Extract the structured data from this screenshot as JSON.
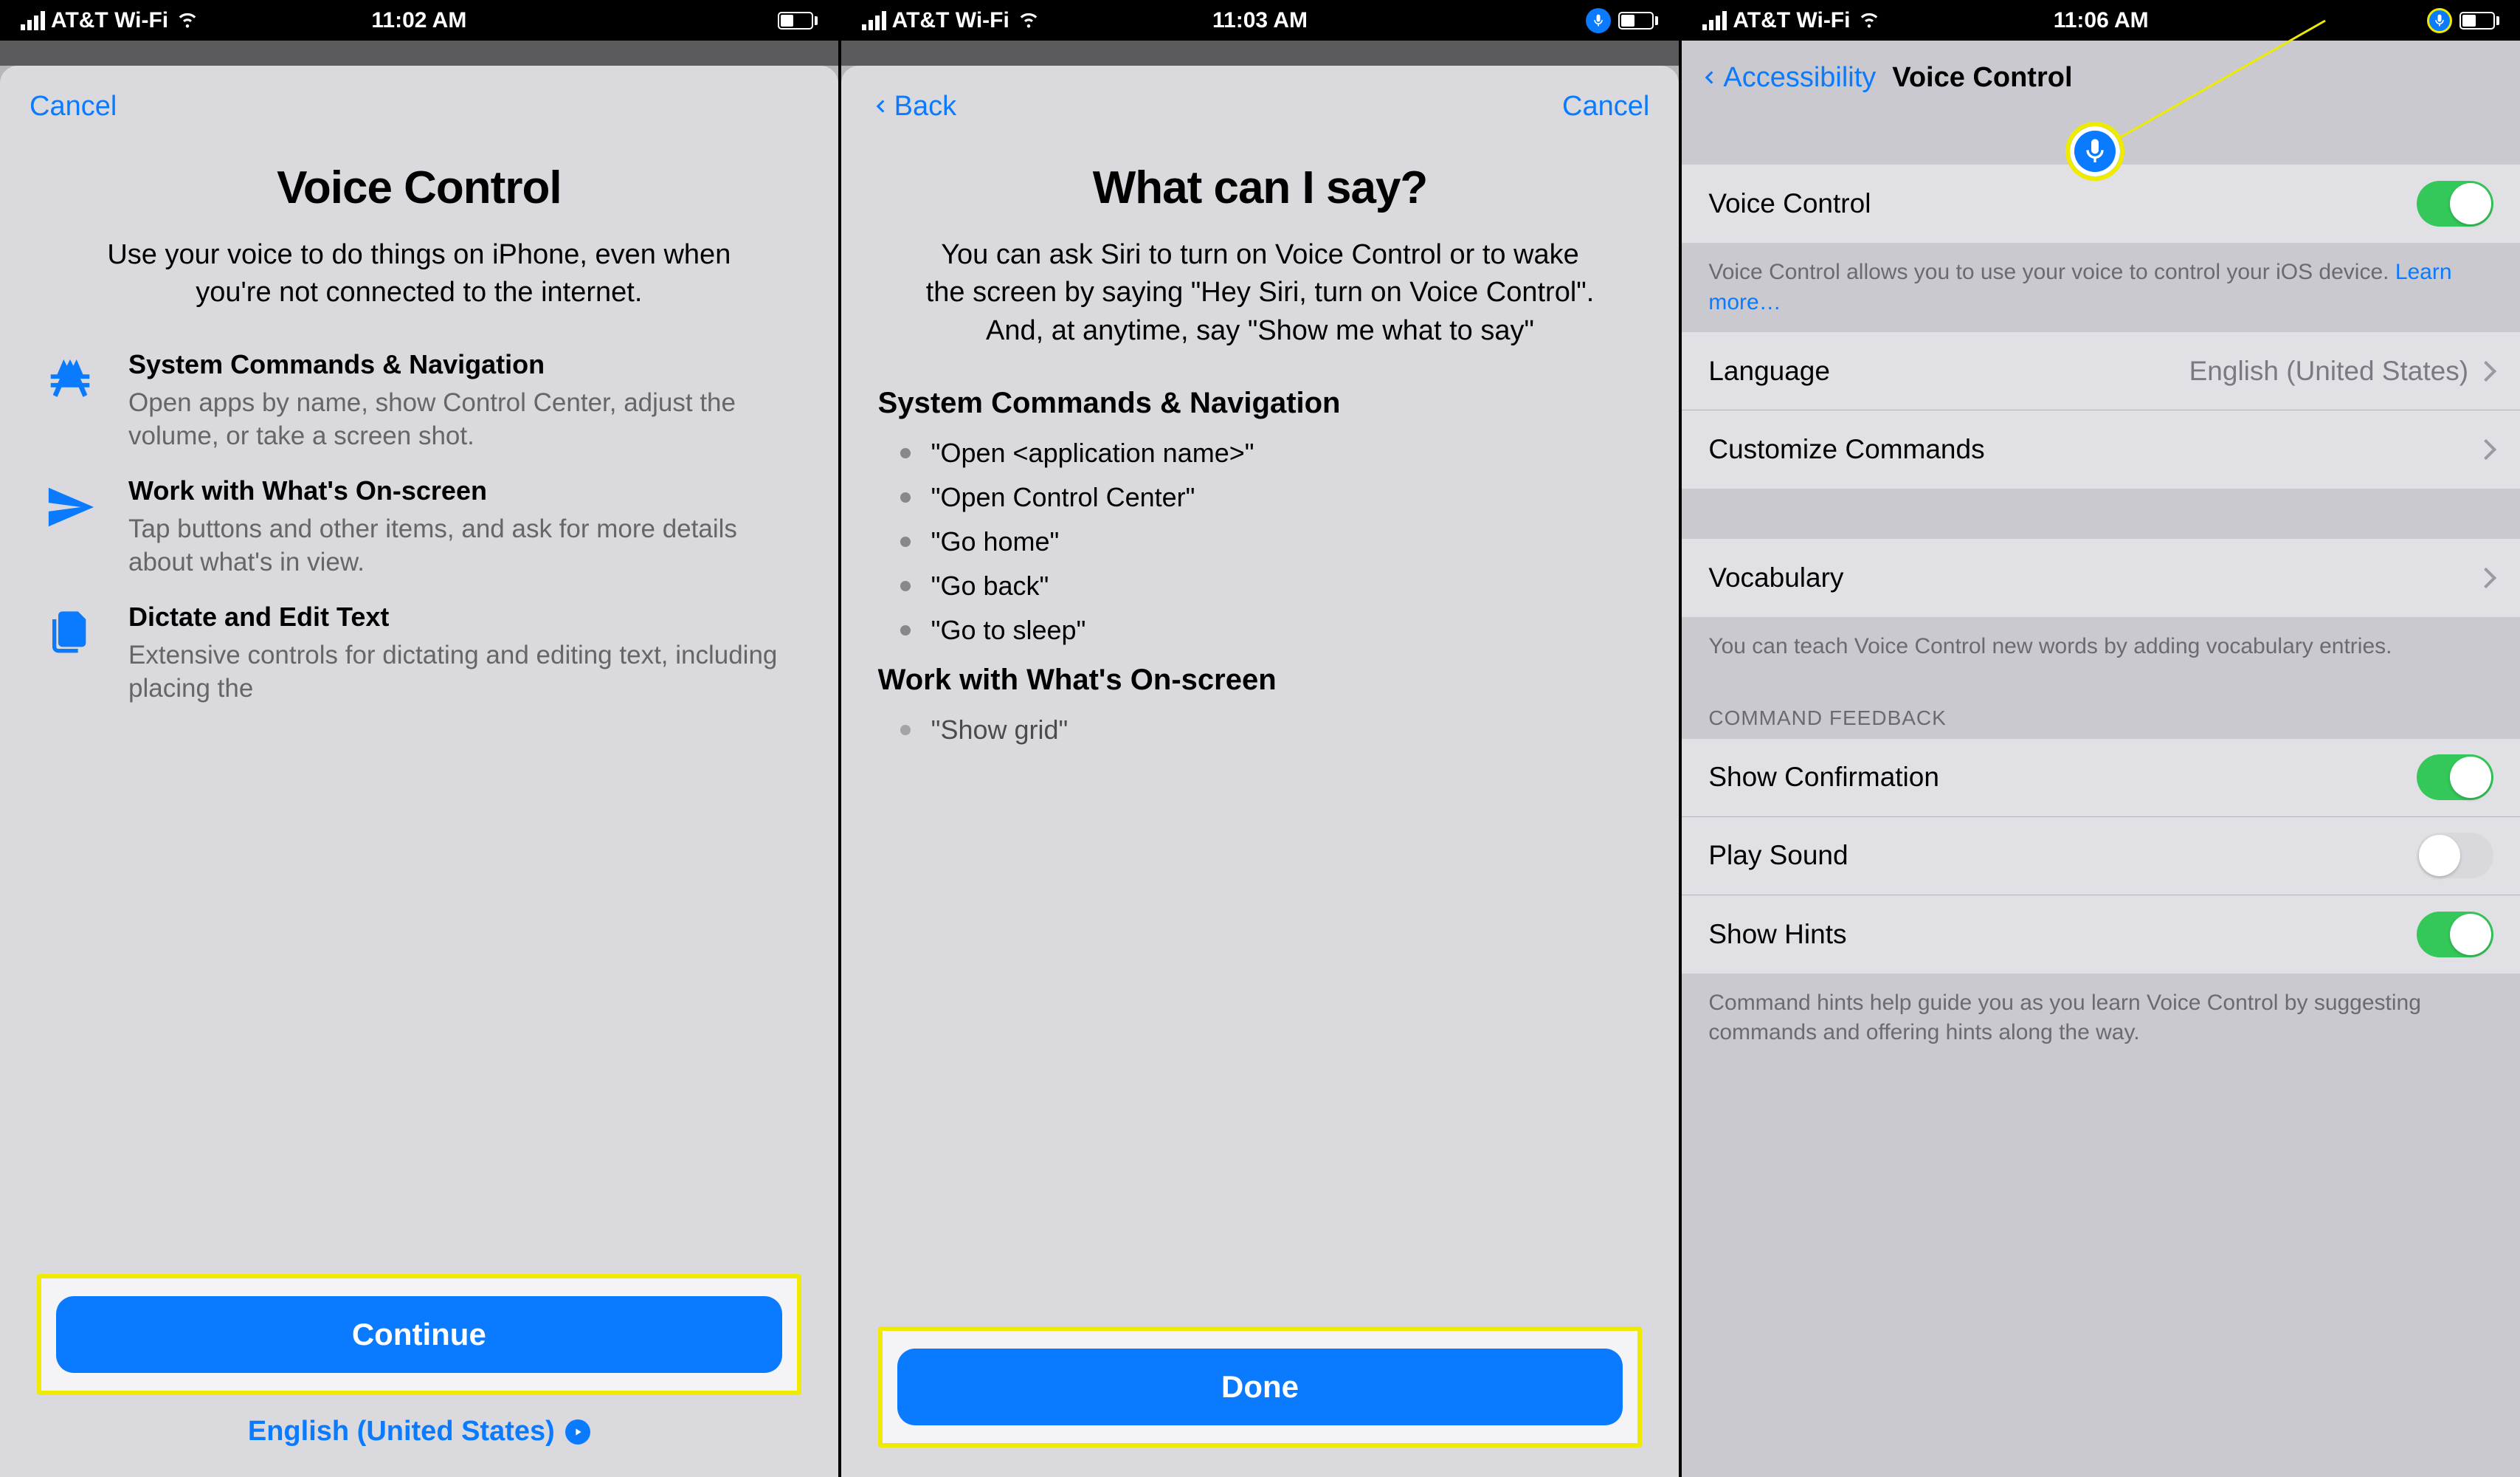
{
  "screens": {
    "s1": {
      "status": {
        "carrier": "AT&T Wi-Fi",
        "time": "11:02 AM",
        "mic": false
      },
      "cancel": "Cancel",
      "title": "Voice Control",
      "subtitle": "Use your voice to do things on iPhone, even when you're not connected to the internet.",
      "features": {
        "f1": {
          "title": "System Commands & Navigation",
          "desc": "Open apps by name, show Control Center, adjust the volume, or take a screen shot."
        },
        "f2": {
          "title": "Work with What's On-screen",
          "desc": "Tap buttons and other items, and ask for more details about what's in view."
        },
        "f3": {
          "title": "Dictate and Edit Text",
          "desc": "Extensive controls for dictating and editing text, including placing the"
        }
      },
      "continue": "Continue",
      "language": "English (United States)"
    },
    "s2": {
      "status": {
        "carrier": "AT&T Wi-Fi",
        "time": "11:03 AM",
        "mic": true
      },
      "back": "Back",
      "cancel": "Cancel",
      "title": "What can I say?",
      "subtitle": "You can ask Siri to turn on Voice Control or to wake the screen by saying \"Hey Siri, turn on Voice Control\". And, at anytime, say \"Show me what to say\"",
      "section1": "System Commands & Navigation",
      "bullets1": {
        "b1": "\"Open <application name>\"",
        "b2": "\"Open Control Center\"",
        "b3": "\"Go home\"",
        "b4": "\"Go back\"",
        "b5": "\"Go to sleep\""
      },
      "section2": "Work with What's On-screen",
      "bullets2": {
        "b1": "\"Show grid\""
      },
      "done": "Done"
    },
    "s3": {
      "status": {
        "carrier": "AT&T Wi-Fi",
        "time": "11:06 AM",
        "mic": true
      },
      "back": "Accessibility",
      "title": "Voice Control",
      "rows": {
        "voiceControl": "Voice Control",
        "voiceControlDesc": "Voice Control allows you to use your voice to control your iOS device. ",
        "learnMore": "Learn more…",
        "language": "Language",
        "languageValue": "English (United States)",
        "customize": "Customize Commands",
        "vocabulary": "Vocabulary",
        "vocabDesc": "You can teach Voice Control new words by adding vocabulary entries.",
        "feedbackHeader": "COMMAND FEEDBACK",
        "showConfirmation": "Show Confirmation",
        "playSound": "Play Sound",
        "showHints": "Show Hints",
        "hintsDesc": "Command hints help guide you as you learn Voice Control by suggesting commands and offering hints along the way."
      }
    }
  }
}
